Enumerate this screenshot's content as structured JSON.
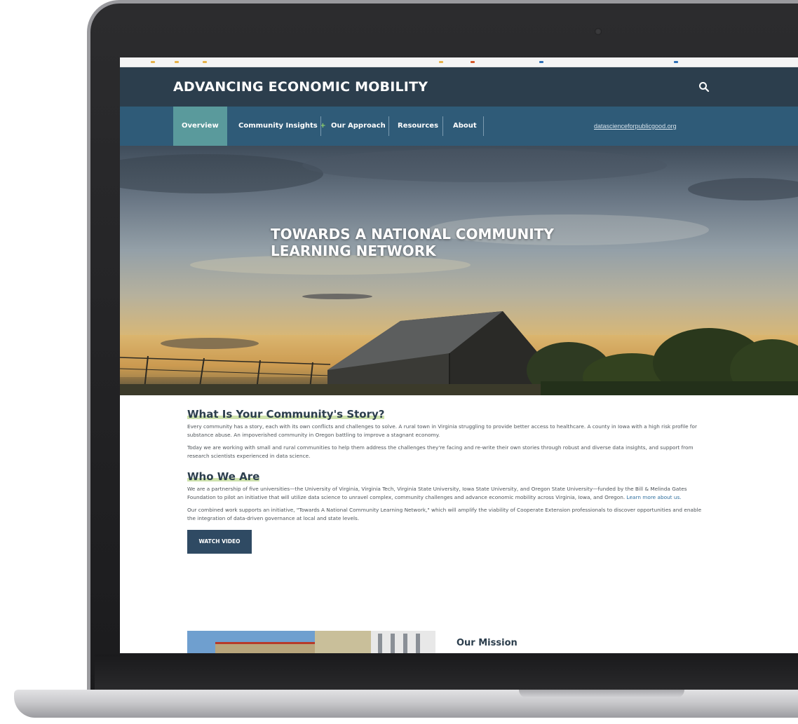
{
  "header": {
    "title": "ADVANCING ECONOMIC MOBILITY",
    "search_icon": "search-icon"
  },
  "nav": {
    "items": [
      {
        "label": "Overview",
        "active": true
      },
      {
        "label": "Community Insights",
        "suffix": "+"
      },
      {
        "label": "Our Approach"
      },
      {
        "label": "Resources"
      },
      {
        "label": "About"
      }
    ],
    "external_link": "datascienceforpublicgood.org"
  },
  "hero": {
    "title": "TOWARDS A NATIONAL COMMUNITY LEARNING NETWORK"
  },
  "story": {
    "heading": "What Is Your Community's Story?",
    "p1": "Every community has a story, each with its own conflicts and challenges to solve. A rural town in Virginia struggling to provide better access to healthcare. A county in Iowa with a high risk profile for substance abuse. An impoverished community in Oregon battling to improve a stagnant economy.",
    "p2": "Today we are working with small and rural communities to help them address the challenges they're facing and re-write their own stories through robust and diverse data insights, and support from research scientists experienced in data science."
  },
  "who": {
    "heading": "Who We Are",
    "p1": "We are a partnership of five universities—the University of Virginia, Virginia Tech, Virginia State University, Iowa State University, and Oregon State University—funded by the Bill & Melinda Gates Foundation to pilot an initiative that will utilize data science to unravel complex, community challenges and advance economic mobility across Virginia, Iowa, and Oregon.",
    "learn_more": "Learn more about us.",
    "p2": "Our combined work supports an initiative, \"Towards A National Community Learning Network,\" which will amplify the viability of Cooperate Extension professionals to discover opportunities and enable the integration of data-driven governance at local and state levels.",
    "button": "WATCH VIDEO"
  },
  "mission": {
    "heading": "Our Mission"
  },
  "colors": {
    "header_bg": "#2c3e4d",
    "nav_bg": "#2f5b78",
    "nav_active": "#5a9a9c",
    "accent_green": "#8fd16a",
    "button_bg": "#2f4a63"
  }
}
